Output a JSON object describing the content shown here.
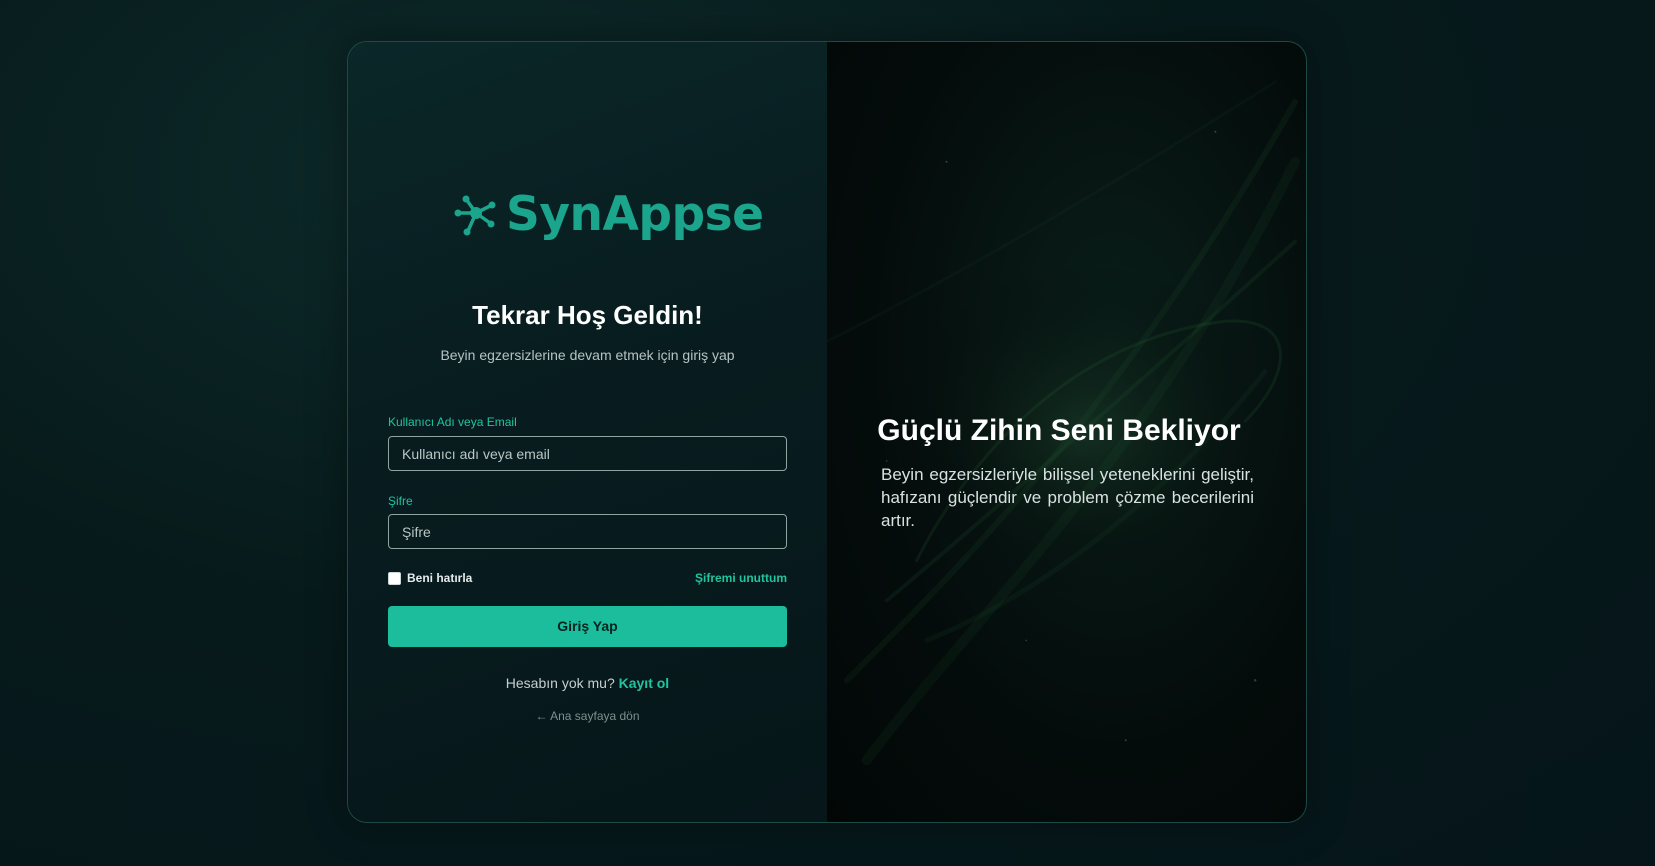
{
  "brand": {
    "name": "SynAppse",
    "icon": "molecule-icon",
    "color": "#1aa58c"
  },
  "login": {
    "title": "Tekrar Hoş Geldin!",
    "subtitle": "Beyin egzersizlerine devam etmek için giriş yap",
    "username_label": "Kullanıcı Adı veya Email",
    "username_placeholder": "Kullanıcı adı veya email",
    "password_label": "Şifre",
    "password_placeholder": "Şifre",
    "remember_label": "Beni hatırla",
    "forgot_label": "Şifremi unuttum",
    "submit_label": "Giriş Yap",
    "signup_prompt": "Hesabın yok mu?",
    "signup_link": "Kayıt ol",
    "back_link": "← Ana sayfaya dön"
  },
  "promo": {
    "title": "Güçlü Zihin Seni Bekliyor",
    "text": "Beyin egzersizleriyle bilişsel yeteneklerini geliştir, hafızanı güçlendir ve problem çözme becerilerini artır."
  },
  "colors": {
    "accent": "#20c49e",
    "button": "#1bbd9d",
    "background": "#071a1b"
  }
}
